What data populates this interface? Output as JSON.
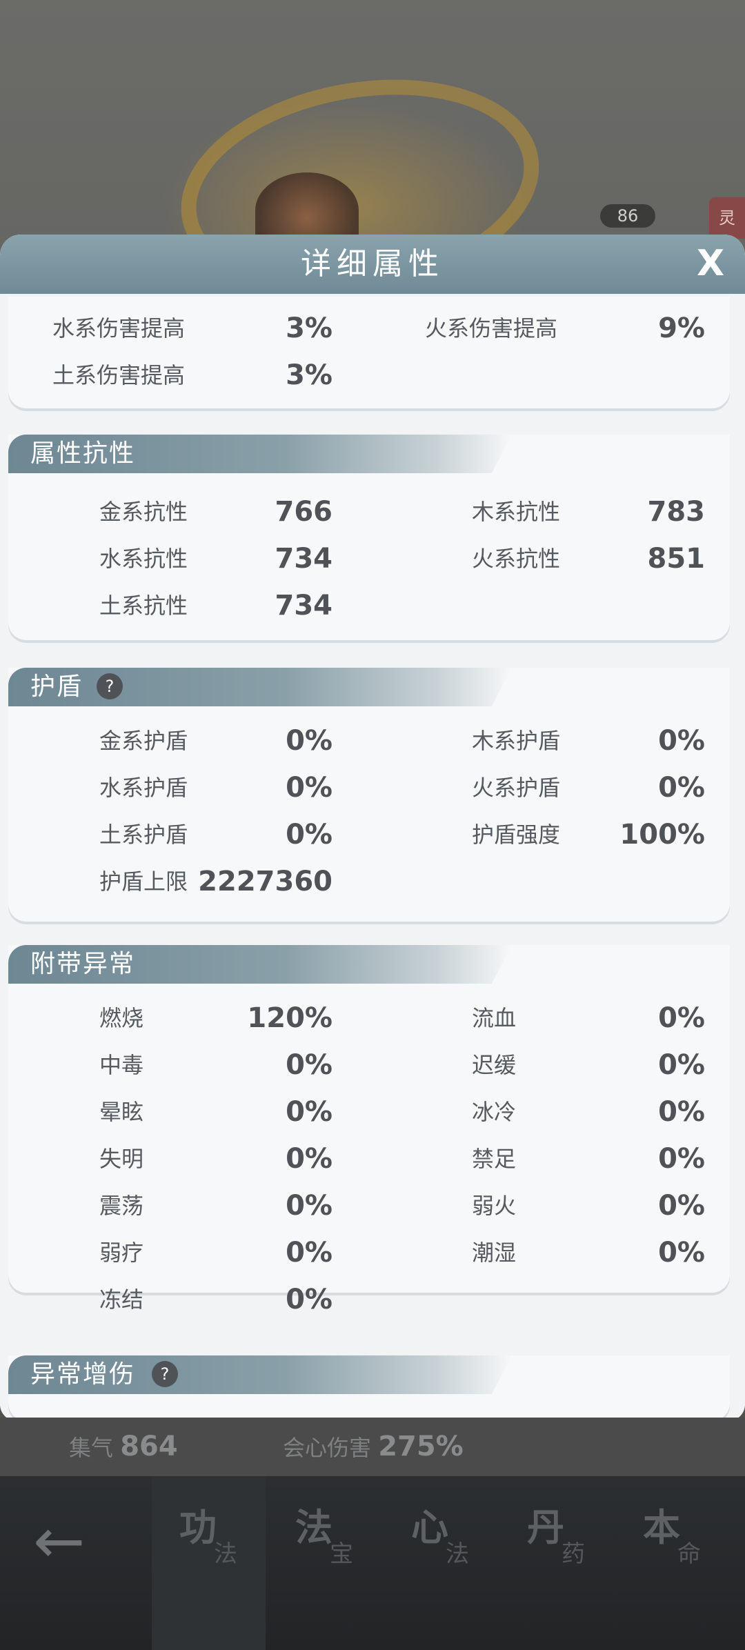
{
  "modal": {
    "title": "详细属性",
    "close": "X"
  },
  "elemental_damage": [
    {
      "label": "水系伤害提高",
      "value": "3%"
    },
    {
      "label": "火系伤害提高",
      "value": "9%"
    },
    {
      "label": "土系伤害提高",
      "value": "3%"
    }
  ],
  "resistance": {
    "title": "属性抗性",
    "items": [
      {
        "label": "金系抗性",
        "value": "766"
      },
      {
        "label": "木系抗性",
        "value": "783"
      },
      {
        "label": "水系抗性",
        "value": "734"
      },
      {
        "label": "火系抗性",
        "value": "851"
      },
      {
        "label": "土系抗性",
        "value": "734"
      }
    ]
  },
  "shield": {
    "title": "护盾",
    "help": "?",
    "items": [
      {
        "label": "金系护盾",
        "value": "0%"
      },
      {
        "label": "木系护盾",
        "value": "0%"
      },
      {
        "label": "水系护盾",
        "value": "0%"
      },
      {
        "label": "火系护盾",
        "value": "0%"
      },
      {
        "label": "土系护盾",
        "value": "0%"
      },
      {
        "label": "护盾强度",
        "value": "100%"
      },
      {
        "label": "护盾上限",
        "value": "2227360"
      }
    ]
  },
  "abnormal": {
    "title": "附带异常",
    "items": [
      {
        "label": "燃烧",
        "value": "120%"
      },
      {
        "label": "流血",
        "value": "0%"
      },
      {
        "label": "中毒",
        "value": "0%"
      },
      {
        "label": "迟缓",
        "value": "0%"
      },
      {
        "label": "晕眩",
        "value": "0%"
      },
      {
        "label": "冰冷",
        "value": "0%"
      },
      {
        "label": "失明",
        "value": "0%"
      },
      {
        "label": "禁足",
        "value": "0%"
      },
      {
        "label": "震荡",
        "value": "0%"
      },
      {
        "label": "弱火",
        "value": "0%"
      },
      {
        "label": "弱疗",
        "value": "0%"
      },
      {
        "label": "潮湿",
        "value": "0%"
      },
      {
        "label": "冻结",
        "value": "0%"
      }
    ]
  },
  "abnormal_bonus": {
    "title": "异常增伤",
    "help": "?"
  },
  "background": {
    "badge": "86",
    "tag": "灵"
  },
  "bottom_stats": [
    {
      "label": "集气",
      "value": "864"
    },
    {
      "label": "会心伤害",
      "value": "275%"
    }
  ],
  "nav": {
    "back": "←",
    "tabs": [
      {
        "main": "功",
        "sub": "法"
      },
      {
        "main": "法",
        "sub": "宝"
      },
      {
        "main": "心",
        "sub": "法"
      },
      {
        "main": "丹",
        "sub": "药"
      },
      {
        "main": "本",
        "sub": "命"
      }
    ]
  }
}
